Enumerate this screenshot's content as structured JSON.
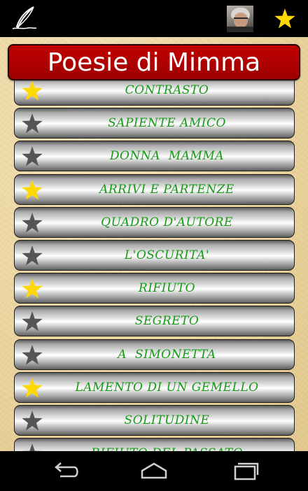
{
  "app": {
    "title": "Poesie di Mimma"
  },
  "actionbar": {
    "left_icon": "quill-pen-icon",
    "avatar": "author-portrait",
    "right_icon": "favorites-star-icon"
  },
  "colors": {
    "title_bg": "#b00000",
    "label_text": "#179a17",
    "star_on": "#ffd800",
    "star_off": "#555555",
    "background": "#ecd6a0"
  },
  "poems": [
    {
      "title": "CONTRASTO",
      "favorite": true
    },
    {
      "title": "SAPIENTE AMICO",
      "favorite": false
    },
    {
      "title": "DONNA  MAMMA",
      "favorite": false
    },
    {
      "title": "ARRIVI E PARTENZE",
      "favorite": true
    },
    {
      "title": "QUADRO D'AUTORE",
      "favorite": false
    },
    {
      "title": "L'OSCURITA'",
      "favorite": false
    },
    {
      "title": "RIFIUTO",
      "favorite": true
    },
    {
      "title": "SEGRETO",
      "favorite": false
    },
    {
      "title": "A  SIMONETTA",
      "favorite": false
    },
    {
      "title": "LAMENTO DI UN GEMELLO",
      "favorite": true
    },
    {
      "title": "SOLITUDINE",
      "favorite": false
    },
    {
      "title": "RIFIUTO DEL PASSATO",
      "favorite": false
    }
  ],
  "navbar": {
    "back": "back-icon",
    "home": "home-icon",
    "recents": "recent-apps-icon"
  }
}
